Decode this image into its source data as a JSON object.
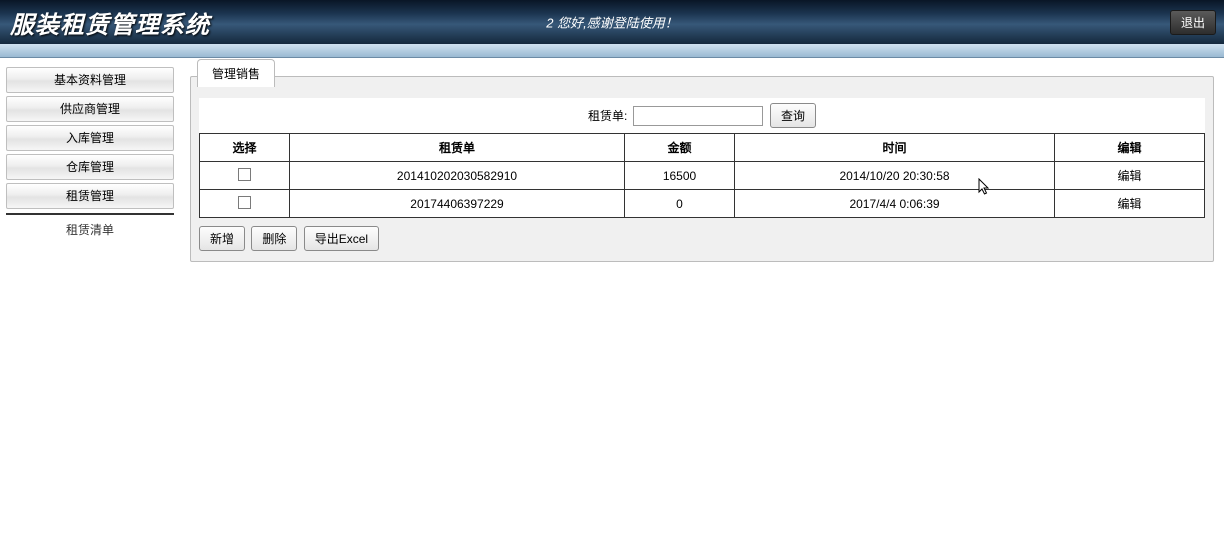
{
  "header": {
    "title": "服装租赁管理系统",
    "welcome": "2 您好,感谢登陆使用！",
    "logout": "退出"
  },
  "sidebar": {
    "items": [
      {
        "label": "基本资料管理"
      },
      {
        "label": "供应商管理"
      },
      {
        "label": "入库管理"
      },
      {
        "label": "仓库管理"
      },
      {
        "label": "租赁管理"
      }
    ],
    "sub_item": "租赁清单"
  },
  "tab": {
    "label": "管理销售"
  },
  "search": {
    "label": "租赁单:",
    "value": "",
    "button": "查询"
  },
  "table": {
    "headers": {
      "select": "选择",
      "order": "租赁单",
      "amount": "金额",
      "time": "时间",
      "edit": "编辑"
    },
    "rows": [
      {
        "order": "201410202030582910",
        "amount": "16500",
        "time": "2014/10/20 20:30:58",
        "edit": "编辑"
      },
      {
        "order": "20174406397229",
        "amount": "0",
        "time": "2017/4/4 0:06:39",
        "edit": "编辑"
      }
    ]
  },
  "actions": {
    "add": "新增",
    "delete": "删除",
    "export": "导出Excel"
  }
}
